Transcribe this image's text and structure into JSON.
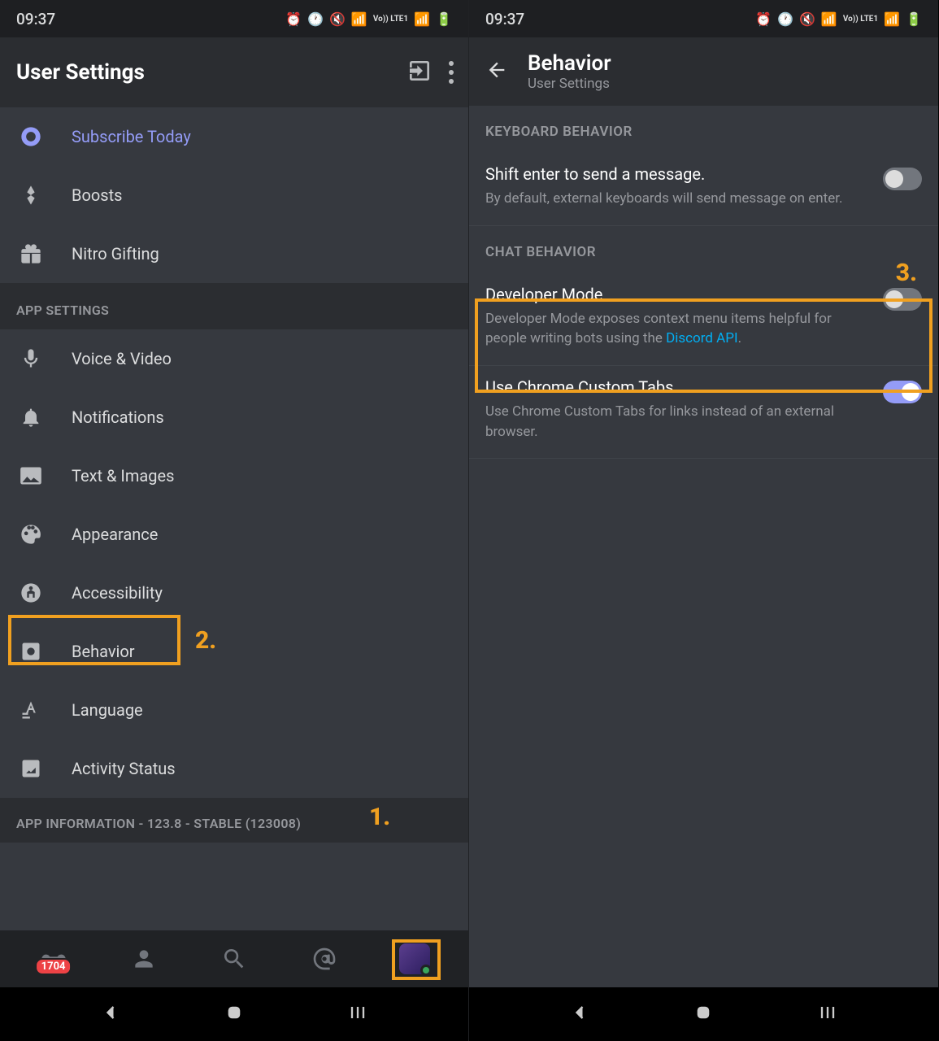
{
  "status": {
    "time": "09:37",
    "lte": "Vo)) LTE1"
  },
  "left": {
    "title": "User Settings",
    "nitro": {
      "subscribe": "Subscribe Today",
      "boosts": "Boosts",
      "gifting": "Nitro Gifting"
    },
    "sections": {
      "app_settings": "APP SETTINGS",
      "app_info": "APP INFORMATION - 123.8 - STABLE (123008)"
    },
    "items": {
      "voice_video": "Voice & Video",
      "notifications": "Notifications",
      "text_images": "Text & Images",
      "appearance": "Appearance",
      "accessibility": "Accessibility",
      "behavior": "Behavior",
      "language": "Language",
      "activity_status": "Activity Status"
    },
    "tabbar": {
      "badge": "1704"
    },
    "annotations": {
      "one": "1.",
      "two": "2."
    }
  },
  "right": {
    "title": "Behavior",
    "subtitle": "User Settings",
    "keyboard_behavior": "KEYBOARD BEHAVIOR",
    "chat_behavior": "CHAT BEHAVIOR",
    "shift_enter": {
      "title": "Shift enter to send a message.",
      "desc": "By default, external keyboards will send message on enter."
    },
    "developer_mode": {
      "title": "Developer Mode",
      "desc": "Developer Mode exposes context menu items helpful for people writing bots using the ",
      "link": "Discord API"
    },
    "chrome_tabs": {
      "title": "Use Chrome Custom Tabs",
      "desc": "Use Chrome Custom Tabs for links instead of an external browser."
    },
    "annotations": {
      "three": "3."
    }
  }
}
